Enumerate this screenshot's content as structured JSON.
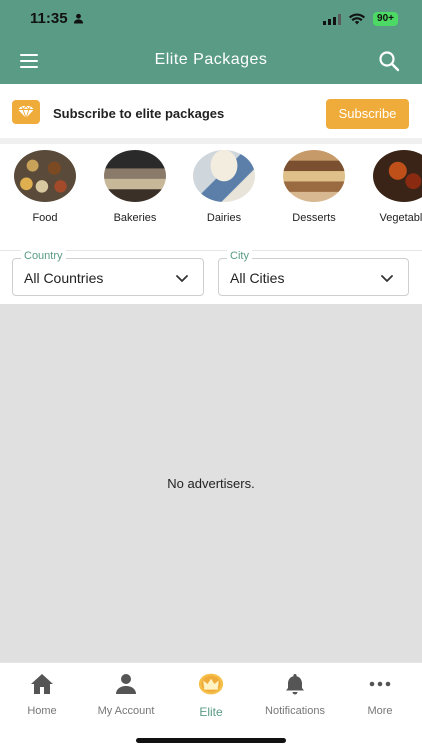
{
  "status": {
    "time": "11:35",
    "battery": "90+"
  },
  "header": {
    "title": "Elite Packages"
  },
  "banner": {
    "text": "Subscribe to elite packages",
    "button": "Subscribe"
  },
  "categories": [
    {
      "label": "Food"
    },
    {
      "label": "Bakeries"
    },
    {
      "label": "Dairies"
    },
    {
      "label": "Desserts"
    },
    {
      "label": "Vegetable"
    }
  ],
  "filters": {
    "country": {
      "legend": "Country",
      "value": "All Countries"
    },
    "city": {
      "legend": "City",
      "value": "All Cities"
    }
  },
  "content": {
    "empty_message": "No advertisers."
  },
  "nav": [
    {
      "label": "Home",
      "icon": "home-icon"
    },
    {
      "label": "My Account",
      "icon": "person-icon"
    },
    {
      "label": "Elite",
      "icon": "crown-icon"
    },
    {
      "label": "Notifications",
      "icon": "bell-icon"
    },
    {
      "label": "More",
      "icon": "more-icon"
    }
  ],
  "colors": {
    "primary": "#5a9b86",
    "accent": "#f0ac3a",
    "content_bg": "#e0e0e0"
  }
}
